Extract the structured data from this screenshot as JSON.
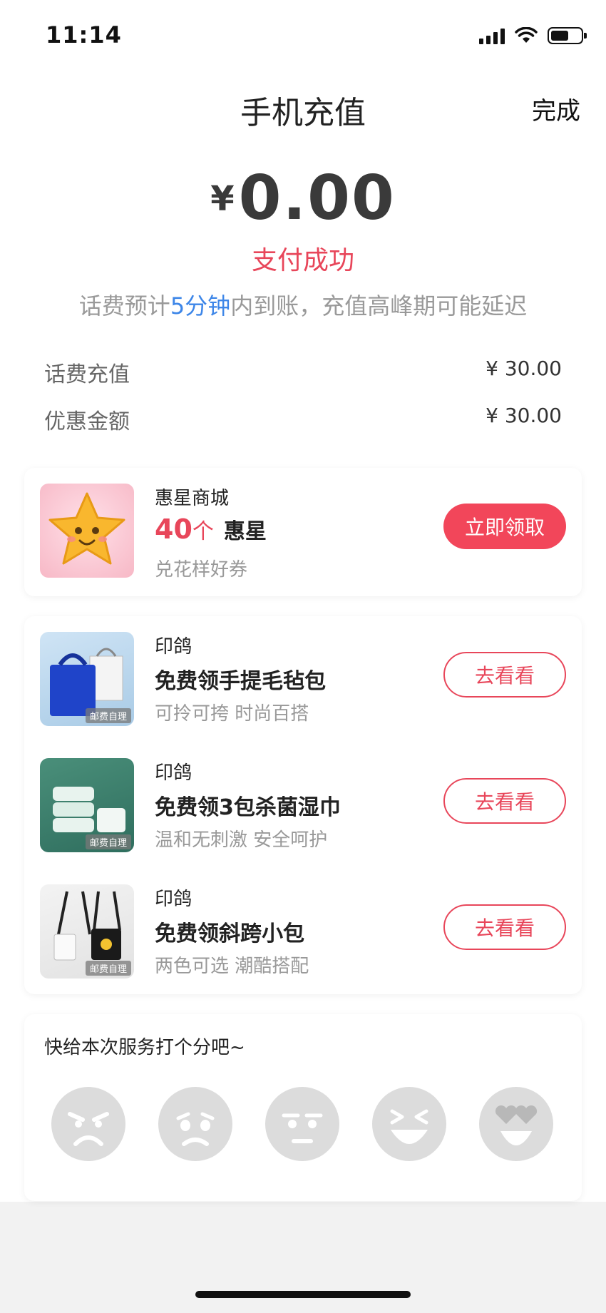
{
  "status_bar": {
    "time": "11:14"
  },
  "nav": {
    "title": "手机充值",
    "done_label": "完成"
  },
  "payment": {
    "currency_symbol": "¥",
    "amount": "0.00",
    "status": "支付成功",
    "notice_before": "话费预计",
    "notice_highlight": "5分钟",
    "notice_after": "内到账，充值高峰期可能延迟"
  },
  "details": [
    {
      "label": "话费充值",
      "value": "¥ 30.00"
    },
    {
      "label": "优惠金额",
      "value": "¥ 30.00"
    }
  ],
  "promo": {
    "brand": "惠星商城",
    "coins_count": "40",
    "coins_unit": "个",
    "coins_name": "惠星",
    "subtitle": "兑花样好券",
    "button_label": "立即领取"
  },
  "offers": [
    {
      "brand": "印鸽",
      "title": "免费领手提毛毡包",
      "subtitle": "可拎可挎 时尚百搭",
      "button_label": "去看看",
      "tag": "邮费自理"
    },
    {
      "brand": "印鸽",
      "title": "免费领3包杀菌湿巾",
      "subtitle": "温和无刺激 安全呵护",
      "button_label": "去看看",
      "tag": "邮费自理"
    },
    {
      "brand": "印鸽",
      "title": "免费领斜跨小包",
      "subtitle": "两色可选 潮酷搭配",
      "button_label": "去看看",
      "tag": "邮费自理"
    }
  ],
  "rating": {
    "title": "快给本次服务打个分吧~",
    "faces": [
      "angry-face-icon",
      "sad-face-icon",
      "neutral-face-icon",
      "laughing-face-icon",
      "heart-eyes-face-icon"
    ]
  },
  "colors": {
    "accent": "#e8465a",
    "highlight": "#3d86e8",
    "face_gray": "#dcdcdc"
  }
}
